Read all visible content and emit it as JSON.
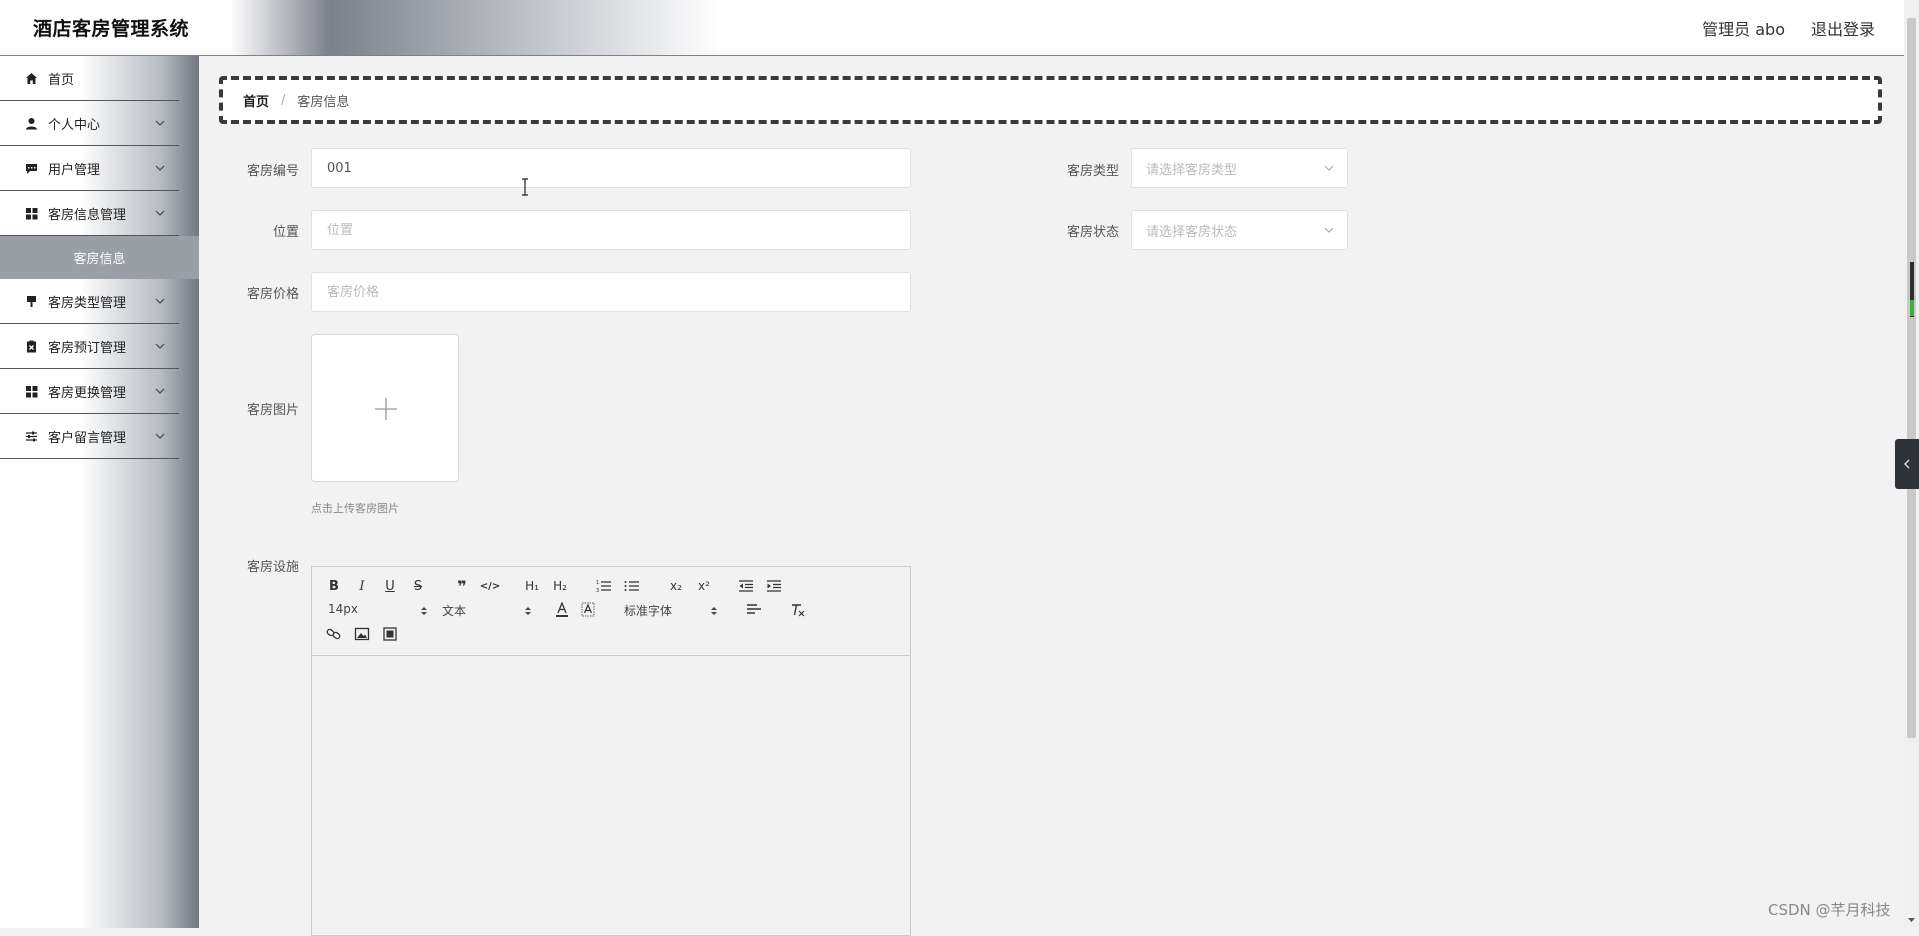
{
  "header": {
    "app_title": "酒店客房管理系统",
    "user_info": "管理员 abo",
    "logout": "退出登录"
  },
  "sidebar": {
    "items": [
      {
        "label": "首页",
        "icon": "home-icon"
      },
      {
        "label": "个人中心",
        "icon": "user-icon"
      },
      {
        "label": "用户管理",
        "icon": "chat-icon"
      },
      {
        "label": "客房信息管理",
        "icon": "grid-icon"
      },
      {
        "label": "客房类型管理",
        "icon": "brush-icon"
      },
      {
        "label": "客房预订管理",
        "icon": "clipboard-x-icon"
      },
      {
        "label": "客房更换管理",
        "icon": "grid-icon"
      },
      {
        "label": "客户留言管理",
        "icon": "sliders-icon"
      }
    ],
    "submenu_active": "客房信息"
  },
  "breadcrumb": {
    "home": "首页",
    "separator": "/",
    "current": "客房信息"
  },
  "form": {
    "room_number_label": "客房编号",
    "room_number_value": "001",
    "location_label": "位置",
    "location_placeholder": "位置",
    "price_label": "客房价格",
    "price_placeholder": "客房价格",
    "image_label": "客房图片",
    "image_hint": "点击上传客房图片",
    "facilities_label": "客房设施",
    "type_label": "客房类型",
    "type_placeholder": "请选择客房类型",
    "status_label": "客房状态",
    "status_placeholder": "请选择客房状态"
  },
  "editor_toolbar": {
    "font_size": "14px",
    "header_select": "文本",
    "font_family": "标准字体",
    "bold": "B",
    "italic": "I",
    "underline": "U",
    "strike": "S",
    "blockquote": "❞",
    "code": "</>",
    "h1": "H₁",
    "h2": "H₂",
    "subscript": "x₂",
    "superscript": "x²"
  },
  "watermark": "CSDN @芊月科技",
  "colors": {
    "sidebar_active": "#9a9ea5",
    "dark_toggle": "#2f3237"
  }
}
